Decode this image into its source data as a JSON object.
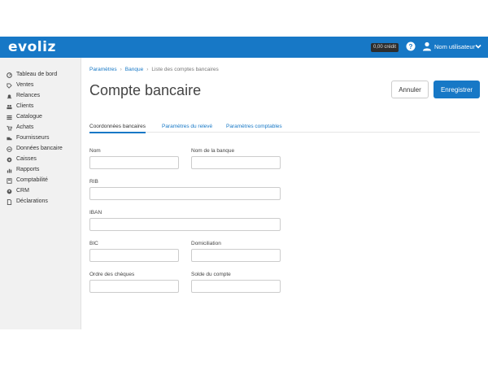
{
  "app": {
    "logo": "evoliz",
    "credit_badge": "0,00 crédit",
    "username": "Nom utilisateur"
  },
  "sidebar": {
    "items": [
      {
        "label": "Tableau de bord",
        "icon": "dashboard-icon"
      },
      {
        "label": "Ventes",
        "icon": "tag-icon"
      },
      {
        "label": "Relances",
        "icon": "bell-icon"
      },
      {
        "label": "Clients",
        "icon": "users-icon"
      },
      {
        "label": "Catalogue",
        "icon": "grid-icon"
      },
      {
        "label": "Achats",
        "icon": "cart-icon"
      },
      {
        "label": "Fournisseurs",
        "icon": "supplier-icon"
      },
      {
        "label": "Données bancaire",
        "icon": "bank-icon"
      },
      {
        "label": "Caisses",
        "icon": "cash-icon"
      },
      {
        "label": "Rapports",
        "icon": "chart-icon"
      },
      {
        "label": "Comptabilité",
        "icon": "accounting-icon"
      },
      {
        "label": "CRM",
        "icon": "crm-icon"
      },
      {
        "label": "Déclarations",
        "icon": "document-icon"
      }
    ]
  },
  "breadcrumb": {
    "items": [
      "Paramètres",
      "Banque",
      "Liste des comptes bancaires"
    ]
  },
  "page": {
    "title": "Compte bancaire",
    "cancel_label": "Annuler",
    "save_label": "Enregistrer"
  },
  "tabs": [
    {
      "label": "Coordonnées bancaires",
      "active": true
    },
    {
      "label": "Paramètres du relevé",
      "active": false
    },
    {
      "label": "Paramètres comptables",
      "active": false
    }
  ],
  "form": {
    "nom": {
      "label": "Nom",
      "value": ""
    },
    "nom_banque": {
      "label": "Nom de la banque",
      "value": ""
    },
    "rib": {
      "label": "RIB",
      "value": ""
    },
    "iban": {
      "label": "IBAN",
      "value": ""
    },
    "bic": {
      "label": "BIC",
      "value": ""
    },
    "domiciliation": {
      "label": "Domiciliation",
      "value": ""
    },
    "ordre_cheques": {
      "label": "Ordre des chèques",
      "value": ""
    },
    "solde_compte": {
      "label": "Solde du compte",
      "value": ""
    }
  },
  "colors": {
    "brand": "#1778c6",
    "sidebar_bg": "#f1f1f1"
  }
}
